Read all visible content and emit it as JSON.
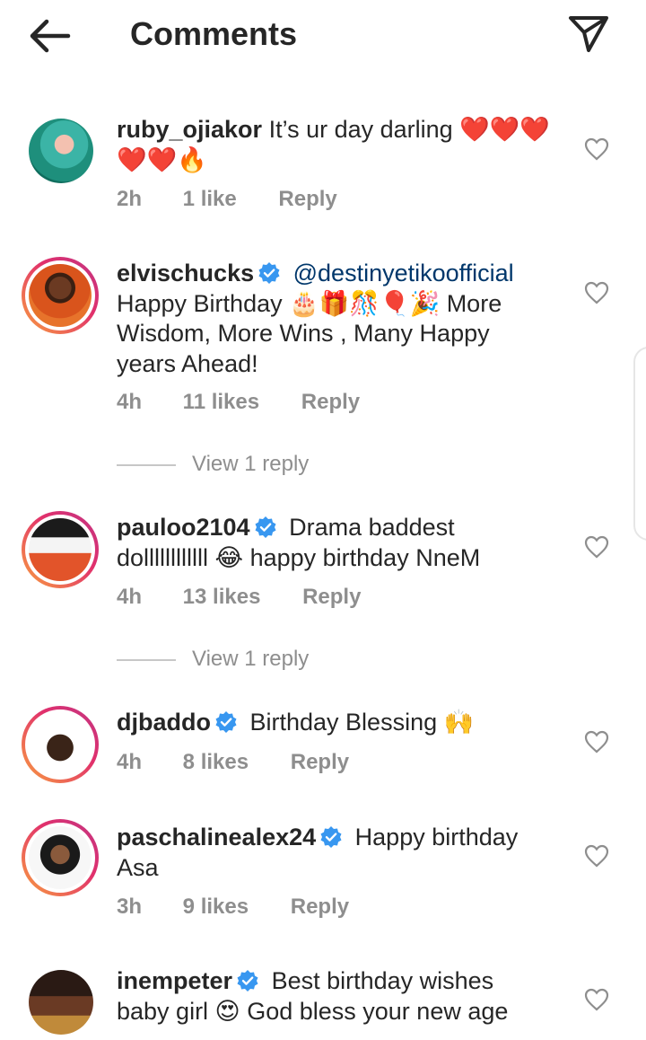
{
  "header": {
    "title": "Comments"
  },
  "comments": [
    {
      "username": "ruby_ojiakor",
      "verified": false,
      "mention": "",
      "text": "It’s ur day darling ❤️❤️❤️❤️❤️🔥",
      "time": "2h",
      "likes": "1 like",
      "reply": "Reply",
      "view_replies": ""
    },
    {
      "username": "elvischucks",
      "verified": true,
      "mention": "@destinyetikoofficial",
      "text": "Happy Birthday 🎂🎁🎊🎈🎉 More Wisdom, More Wins , Many Happy years Ahead!",
      "time": "4h",
      "likes": "11 likes",
      "reply": "Reply",
      "view_replies": "View 1 reply"
    },
    {
      "username": "pauloo2104",
      "verified": true,
      "mention": "",
      "text": "Drama baddest dollllllllllll 😂 happy birthday NneM",
      "time": "4h",
      "likes": "13 likes",
      "reply": "Reply",
      "view_replies": "View 1 reply"
    },
    {
      "username": "djbaddo",
      "verified": true,
      "mention": "",
      "text": "Birthday Blessing 🙌",
      "time": "4h",
      "likes": "8 likes",
      "reply": "Reply",
      "view_replies": ""
    },
    {
      "username": "paschalinealex24",
      "verified": true,
      "mention": "",
      "text": "Happy birthday Asa",
      "time": "3h",
      "likes": "9 likes",
      "reply": "Reply",
      "view_replies": ""
    },
    {
      "username": "inempeter",
      "verified": true,
      "mention": "",
      "text": "Best  birthday wishes baby girl 😍 God bless your new age",
      "time": "",
      "likes": "",
      "reply": "",
      "view_replies": ""
    }
  ],
  "colors": {
    "text": "#262626",
    "meta": "#8e8e8e",
    "verified": "#3897f0",
    "mention": "#00376b"
  },
  "icons": {
    "back": "arrow-left-icon",
    "send": "paper-plane-icon",
    "like": "heart-outline-icon",
    "verified": "verified-badge-icon"
  }
}
